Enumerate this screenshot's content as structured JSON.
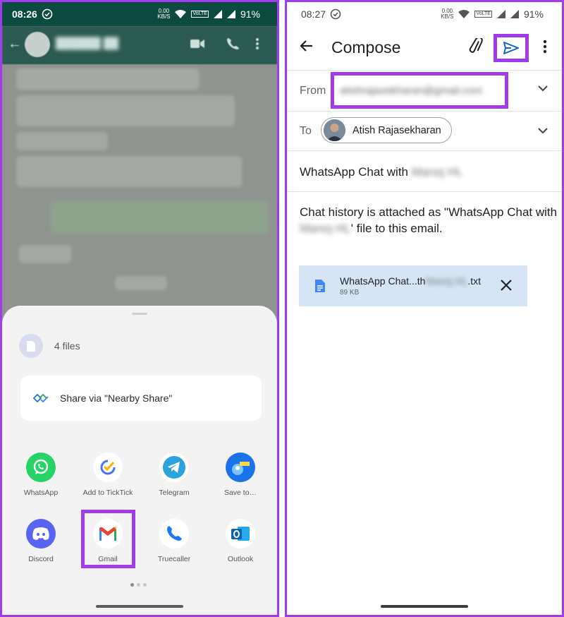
{
  "left": {
    "status_time": "08:26",
    "status_speed": "0.00\nKB/S",
    "status_battery": "91%",
    "sheet": {
      "files_label": "4 files",
      "nearby_label": "Share via \"Nearby Share\"",
      "apps": [
        {
          "label": "WhatsApp",
          "color": "#25d366"
        },
        {
          "label": "Add to TickTick",
          "color": "#ffffff"
        },
        {
          "label": "Telegram",
          "color": "#ffffff"
        },
        {
          "label": "Save to…",
          "color": "#1a73e8"
        },
        {
          "label": "Discord",
          "color": "#5865f2"
        },
        {
          "label": "Gmail",
          "color": "#ffffff"
        },
        {
          "label": "Truecaller",
          "color": "#ffffff"
        },
        {
          "label": "Outlook",
          "color": "#ffffff"
        }
      ]
    }
  },
  "right": {
    "status_time": "08:27",
    "status_speed": "0.00\nKB/S",
    "status_battery": "91%",
    "toolbar": {
      "title": "Compose"
    },
    "from_label": "From",
    "from_value": "atishrajasekharan@gmail.com",
    "to_label": "To",
    "to_name": "Atish Rajasekharan",
    "subject_prefix": "WhatsApp Chat with",
    "subject_name": "Manoj HL",
    "body_part1": "Chat history is attached as \"WhatsApp Chat with",
    "body_name": "Manoj HL",
    "body_part2": "' file to this email.",
    "attachment_name_prefix": "WhatsApp Chat...th",
    "attachment_name_blur": "Manoj HL",
    "attachment_ext": ".txt",
    "attachment_size": "89 KB",
    "highlight_color": "#a23bec"
  }
}
